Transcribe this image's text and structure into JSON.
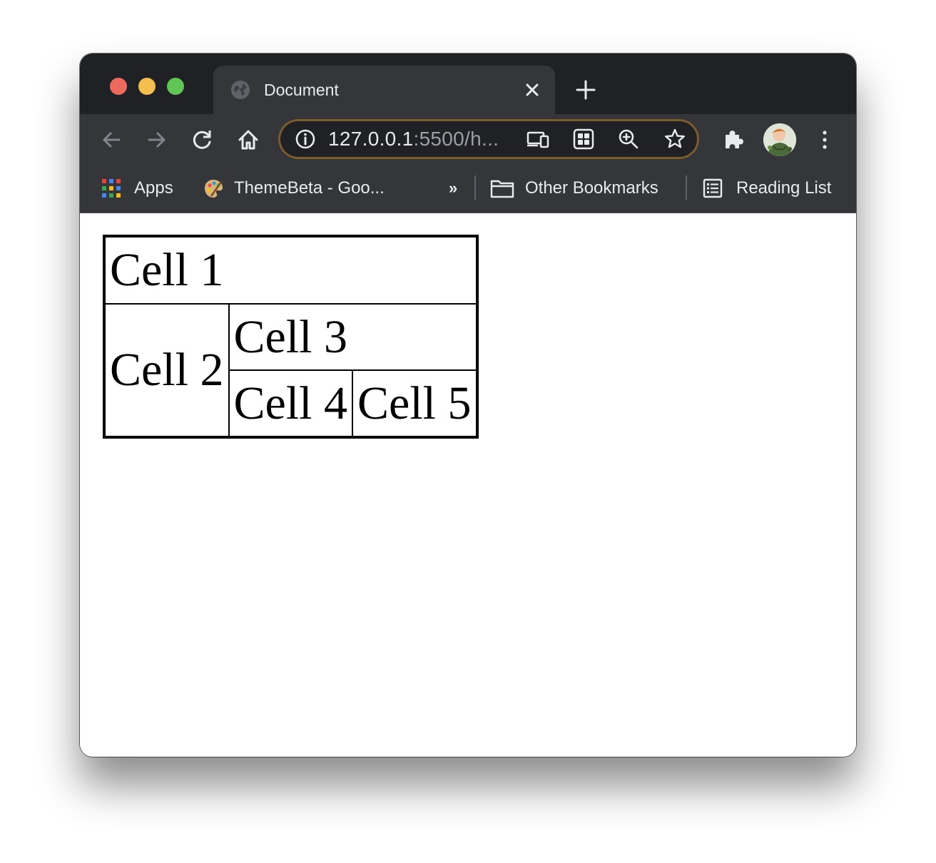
{
  "browser": {
    "traffic_lights": {
      "close": "#ed6a5e",
      "minimize": "#f4bf4f",
      "zoom": "#61c554"
    },
    "tab": {
      "title": "Document",
      "favicon": "globe-icon"
    },
    "omnibox": {
      "url_host": "127.0.0.1",
      "url_rest": ":5500/h..."
    },
    "bookmarks": [
      {
        "label": "Apps",
        "icon": "apps-grid-icon"
      },
      {
        "label": "ThemeBeta - Goo...",
        "icon": "palette-icon"
      },
      {
        "label": "»",
        "icon": "overflow-chevron-icon"
      },
      {
        "label": "Other Bookmarks",
        "icon": "folder-icon"
      },
      {
        "label": "Reading List",
        "icon": "reading-list-icon"
      }
    ],
    "colors": {
      "frame": "#202124",
      "toolbar": "#35363a",
      "text": "#e8eaed",
      "omnibox_border": "#7a5c2e"
    }
  },
  "page": {
    "table": {
      "cell1": "Cell 1",
      "cell2": "Cell 2",
      "cell3": "Cell 3",
      "cell4": "Cell 4",
      "cell5": "Cell 5"
    }
  }
}
